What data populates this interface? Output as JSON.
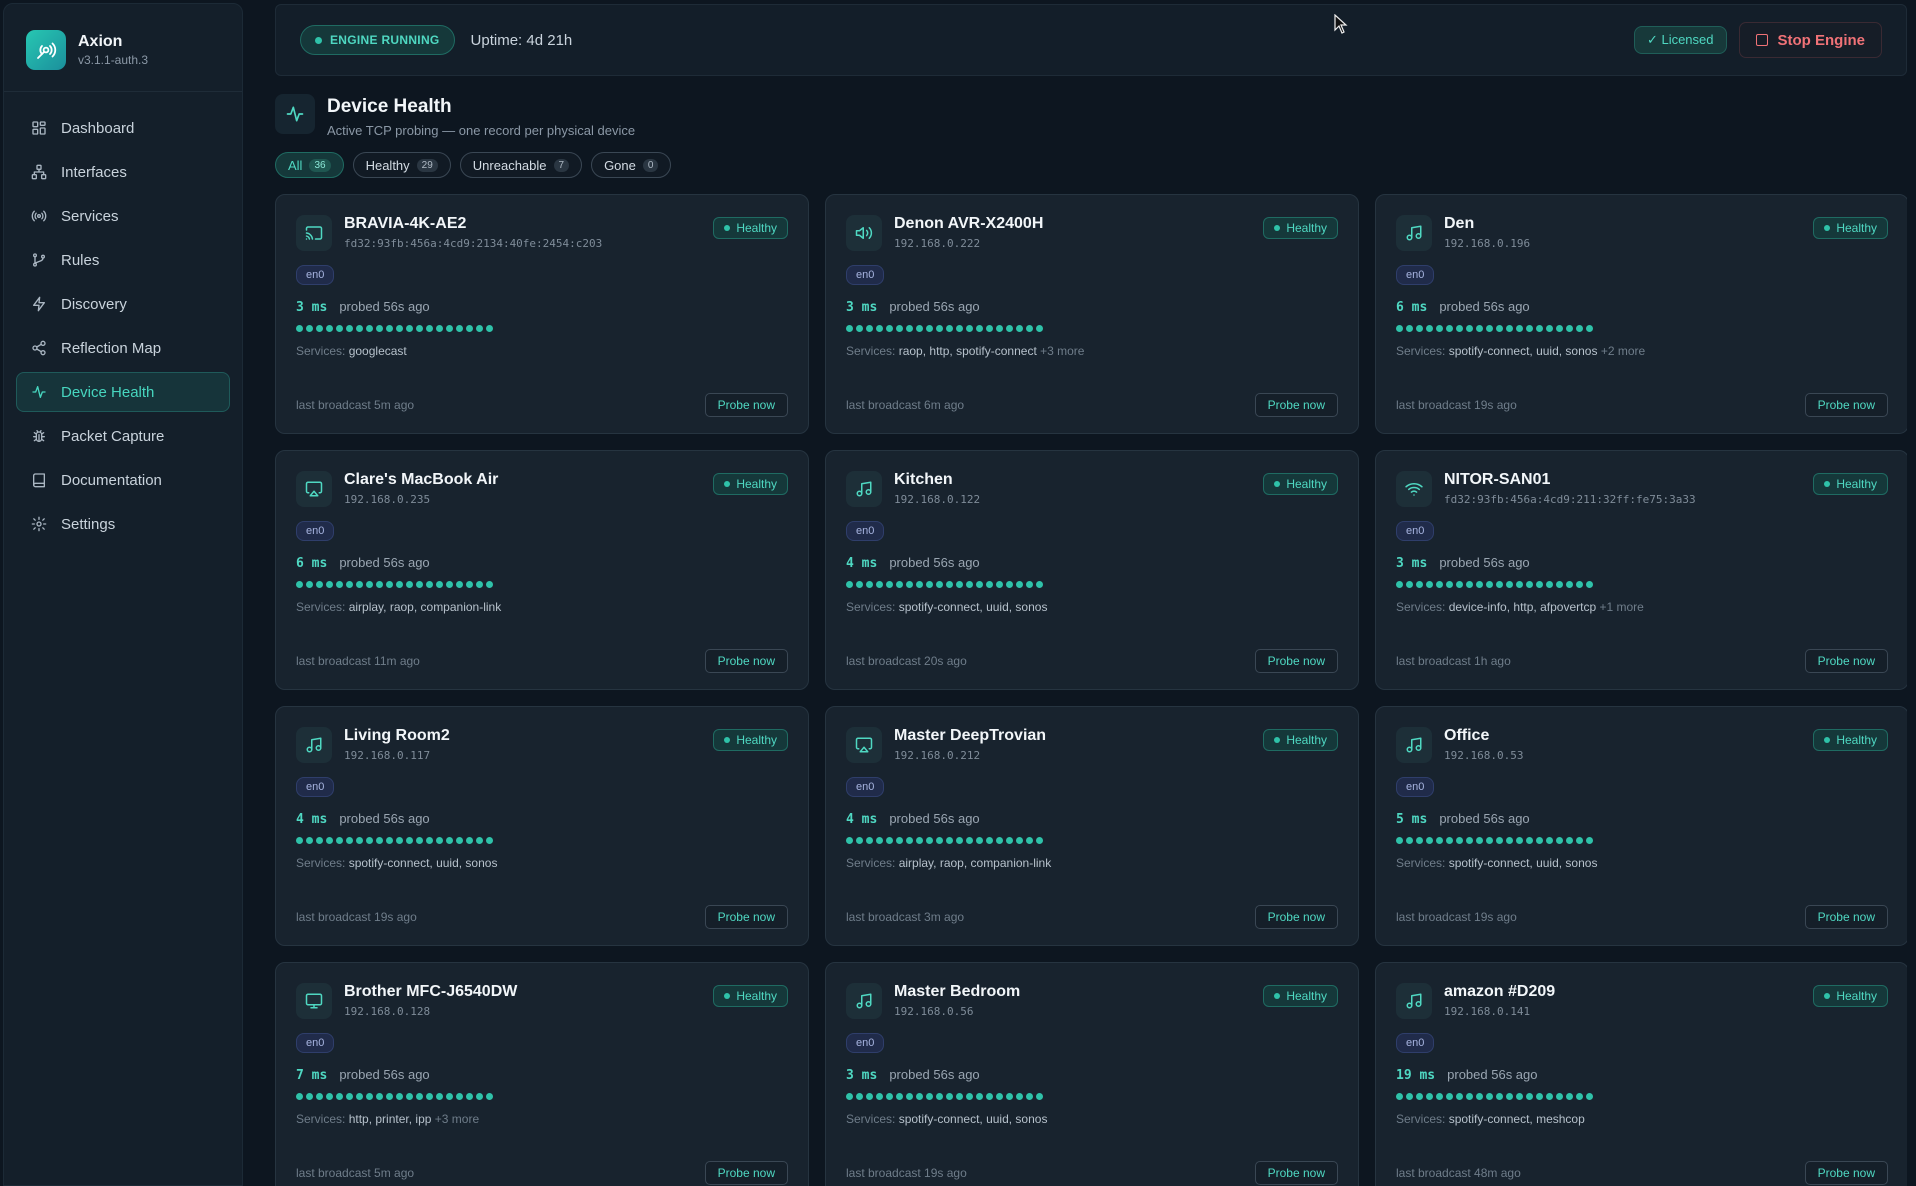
{
  "brand": {
    "name": "Axion",
    "version": "v3.1.1-auth.3"
  },
  "nav": [
    {
      "label": "Dashboard",
      "icon": "grid-icon",
      "active": false
    },
    {
      "label": "Interfaces",
      "icon": "network-icon",
      "active": false
    },
    {
      "label": "Services",
      "icon": "broadcast-icon",
      "active": false
    },
    {
      "label": "Rules",
      "icon": "branch-icon",
      "active": false
    },
    {
      "label": "Discovery",
      "icon": "bolt-icon",
      "active": false
    },
    {
      "label": "Reflection Map",
      "icon": "share-icon",
      "active": false
    },
    {
      "label": "Device Health",
      "icon": "pulse-icon",
      "active": true
    },
    {
      "label": "Packet Capture",
      "icon": "bug-icon",
      "active": false
    },
    {
      "label": "Documentation",
      "icon": "book-icon",
      "active": false
    },
    {
      "label": "Settings",
      "icon": "gear-icon",
      "active": false
    }
  ],
  "topbar": {
    "engine_status": "ENGINE RUNNING",
    "uptime": "Uptime: 4d 21h",
    "licensed": "✓ Licensed",
    "stop_label": "Stop Engine"
  },
  "header": {
    "title": "Device Health",
    "subtitle": "Active TCP probing — one record per physical device"
  },
  "filters": [
    {
      "label": "All",
      "count": "36",
      "active": true
    },
    {
      "label": "Healthy",
      "count": "29",
      "active": false
    },
    {
      "label": "Unreachable",
      "count": "7",
      "active": false
    },
    {
      "label": "Gone",
      "count": "0",
      "active": false
    }
  ],
  "probe_label": "Probe now",
  "services_prefix": "Services:",
  "devices": [
    {
      "name": "BRAVIA-4K-AE2",
      "addr": "fd32:93fb:456a:4cd9:2134:40fe:2454:c203",
      "icon": "cast-icon",
      "status": "Healthy",
      "iface": "en0",
      "latency": "3 ms",
      "probed": "probed 56s ago",
      "services": "googlecast",
      "more": "",
      "last": "last broadcast 5m ago"
    },
    {
      "name": "Denon AVR-X2400H",
      "addr": "192.168.0.222",
      "icon": "speaker-icon",
      "status": "Healthy",
      "iface": "en0",
      "latency": "3 ms",
      "probed": "probed 56s ago",
      "services": "raop, http, spotify-connect",
      "more": "+3 more",
      "last": "last broadcast 6m ago"
    },
    {
      "name": "Den",
      "addr": "192.168.0.196",
      "icon": "music-icon",
      "status": "Healthy",
      "iface": "en0",
      "latency": "6 ms",
      "probed": "probed 56s ago",
      "services": "spotify-connect, uuid, sonos",
      "more": "+2 more",
      "last": "last broadcast 19s ago"
    },
    {
      "name": "Clare's MacBook Air",
      "addr": "192.168.0.235",
      "icon": "airplay-icon",
      "status": "Healthy",
      "iface": "en0",
      "latency": "6 ms",
      "probed": "probed 56s ago",
      "services": "airplay, raop, companion-link",
      "more": "",
      "last": "last broadcast 11m ago"
    },
    {
      "name": "Kitchen",
      "addr": "192.168.0.122",
      "icon": "music-icon",
      "status": "Healthy",
      "iface": "en0",
      "latency": "4 ms",
      "probed": "probed 56s ago",
      "services": "spotify-connect, uuid, sonos",
      "more": "",
      "last": "last broadcast 20s ago"
    },
    {
      "name": "NITOR-SAN01",
      "addr": "fd32:93fb:456a:4cd9:211:32ff:fe75:3a33",
      "icon": "wifi-icon",
      "status": "Healthy",
      "iface": "en0",
      "latency": "3 ms",
      "probed": "probed 56s ago",
      "services": "device-info, http, afpovertcp",
      "more": "+1 more",
      "last": "last broadcast 1h ago"
    },
    {
      "name": "Living Room2",
      "addr": "192.168.0.117",
      "icon": "music-icon",
      "status": "Healthy",
      "iface": "en0",
      "latency": "4 ms",
      "probed": "probed 56s ago",
      "services": "spotify-connect, uuid, sonos",
      "more": "",
      "last": "last broadcast 19s ago"
    },
    {
      "name": "Master DeepTrovian",
      "addr": "192.168.0.212",
      "icon": "airplay-icon",
      "status": "Healthy",
      "iface": "en0",
      "latency": "4 ms",
      "probed": "probed 56s ago",
      "services": "airplay, raop, companion-link",
      "more": "",
      "last": "last broadcast 3m ago"
    },
    {
      "name": "Office",
      "addr": "192.168.0.53",
      "icon": "music-icon",
      "status": "Healthy",
      "iface": "en0",
      "latency": "5 ms",
      "probed": "probed 56s ago",
      "services": "spotify-connect, uuid, sonos",
      "more": "",
      "last": "last broadcast 19s ago"
    },
    {
      "name": "Brother MFC-J6540DW",
      "addr": "192.168.0.128",
      "icon": "monitor-icon",
      "status": "Healthy",
      "iface": "en0",
      "latency": "7 ms",
      "probed": "probed 56s ago",
      "services": "http, printer, ipp",
      "more": "+3 more",
      "last": "last broadcast 5m ago"
    },
    {
      "name": "Master Bedroom",
      "addr": "192.168.0.56",
      "icon": "music-icon",
      "status": "Healthy",
      "iface": "en0",
      "latency": "3 ms",
      "probed": "probed 56s ago",
      "services": "spotify-connect, uuid, sonos",
      "more": "",
      "last": "last broadcast 19s ago"
    },
    {
      "name": "amazon #D209",
      "addr": "192.168.0.141",
      "icon": "music-icon",
      "status": "Healthy",
      "iface": "en0",
      "latency": "19 ms",
      "probed": "probed 56s ago",
      "services": "spotify-connect, meshcop",
      "more": "",
      "last": "last broadcast 48m ago"
    }
  ]
}
